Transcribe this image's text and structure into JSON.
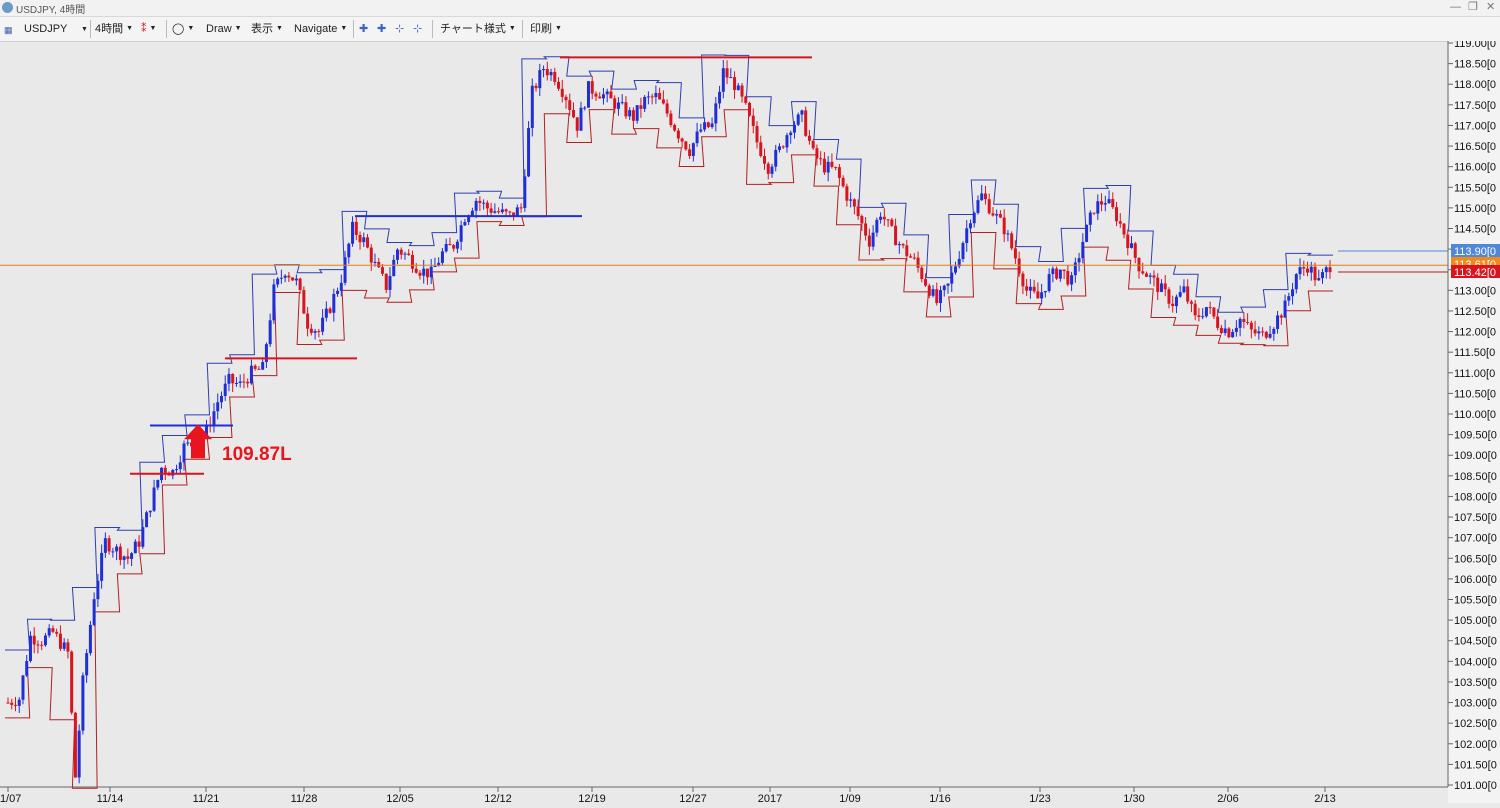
{
  "window": {
    "title": "USDJPY, 4時間"
  },
  "toolbar": {
    "symbol": "USDJPY",
    "timeframe": "4時間",
    "draw": "Draw",
    "view": "表示",
    "navigate": "Navigate",
    "chart_style": "チャート様式",
    "print": "印刷"
  },
  "annotation": {
    "label": "109.87L",
    "color": "#e8141e"
  },
  "price_tags": [
    "113.90",
    "113.61",
    "113.42"
  ],
  "chart_data": {
    "type": "candlestick",
    "symbol": "USDJPY",
    "timeframe": "4時間",
    "x_tick_labels": [
      "11/07",
      "11/14",
      "11/21",
      "11/28",
      "12/05",
      "12/12",
      "12/19",
      "12/27",
      "2017",
      "1/09",
      "1/16",
      "1/23",
      "1/30",
      "2/06",
      "2/13"
    ],
    "y_tick_labels": [
      "119.00",
      "118.50",
      "118.00",
      "117.50",
      "117.00",
      "116.50",
      "116.00",
      "115.50",
      "115.00",
      "114.50",
      "114.00",
      "113.50",
      "113.00",
      "112.50",
      "112.00",
      "111.50",
      "111.00",
      "110.50",
      "110.00",
      "109.50",
      "109.00",
      "108.50",
      "108.00",
      "107.50",
      "107.00",
      "106.50",
      "106.00",
      "105.50",
      "105.00",
      "104.50",
      "104.00",
      "103.50",
      "103.00",
      "102.50",
      "102.00",
      "101.50",
      "101.00"
    ],
    "y_range": [
      101.0,
      119.0
    ],
    "current_price": 113.61,
    "colors": {
      "up": "#1f2fd8",
      "down": "#d8141e",
      "band_upper": "#2d3fae",
      "band_lower": "#b02020",
      "current_line": "#e07f18"
    },
    "close_path": [
      [
        0,
        103.0
      ],
      [
        0.3,
        103.1
      ],
      [
        0.6,
        104.6
      ],
      [
        0.9,
        104.5
      ],
      [
        1.2,
        104.7
      ],
      [
        1.6,
        104.2
      ],
      [
        1.8,
        101.2
      ],
      [
        2.0,
        103.5
      ],
      [
        2.3,
        105.6
      ],
      [
        2.6,
        106.9
      ],
      [
        2.9,
        106.7
      ],
      [
        3.2,
        106.5
      ],
      [
        3.5,
        106.9
      ],
      [
        3.8,
        107.8
      ],
      [
        4.1,
        108.7
      ],
      [
        4.4,
        108.6
      ],
      [
        4.7,
        109.2
      ],
      [
        5.0,
        109.3
      ],
      [
        5.3,
        109.6
      ],
      [
        5.6,
        110.3
      ],
      [
        5.9,
        110.8
      ],
      [
        6.2,
        110.7
      ],
      [
        6.5,
        111.0
      ],
      [
        6.8,
        111.1
      ],
      [
        7.1,
        113.0
      ],
      [
        7.4,
        113.5
      ],
      [
        7.7,
        113.2
      ],
      [
        8.0,
        112.2
      ],
      [
        8.3,
        112.0
      ],
      [
        8.6,
        112.6
      ],
      [
        8.9,
        113.3
      ],
      [
        9.2,
        114.5
      ],
      [
        9.5,
        114.2
      ],
      [
        9.8,
        113.6
      ],
      [
        10.1,
        113.1
      ],
      [
        10.4,
        114.0
      ],
      [
        10.7,
        113.8
      ],
      [
        11.0,
        113.5
      ],
      [
        11.3,
        113.4
      ],
      [
        11.6,
        113.9
      ],
      [
        11.9,
        114.1
      ],
      [
        12.2,
        114.8
      ],
      [
        12.5,
        115.2
      ],
      [
        12.8,
        115.0
      ],
      [
        13.1,
        114.9
      ],
      [
        13.4,
        114.8
      ],
      [
        13.7,
        115.0
      ],
      [
        14.0,
        117.8
      ],
      [
        14.3,
        118.4
      ],
      [
        14.6,
        118.2
      ],
      [
        14.9,
        117.7
      ],
      [
        15.2,
        117.0
      ],
      [
        15.5,
        117.9
      ],
      [
        15.8,
        117.8
      ],
      [
        16.1,
        117.6
      ],
      [
        16.4,
        117.4
      ],
      [
        16.7,
        117.2
      ],
      [
        17.0,
        117.6
      ],
      [
        17.3,
        117.7
      ],
      [
        17.6,
        117.3
      ],
      [
        17.9,
        116.8
      ],
      [
        18.2,
        116.4
      ],
      [
        18.5,
        116.9
      ],
      [
        18.8,
        117.0
      ],
      [
        19.1,
        118.3
      ],
      [
        19.4,
        118.0
      ],
      [
        19.7,
        117.4
      ],
      [
        20.0,
        116.6
      ],
      [
        20.3,
        116.0
      ],
      [
        20.6,
        116.4
      ],
      [
        20.9,
        117.0
      ],
      [
        21.2,
        117.2
      ],
      [
        21.5,
        116.3
      ],
      [
        21.8,
        116.0
      ],
      [
        22.1,
        115.9
      ],
      [
        22.4,
        115.3
      ],
      [
        22.7,
        114.8
      ],
      [
        23.0,
        114.2
      ],
      [
        23.3,
        114.9
      ],
      [
        23.6,
        114.4
      ],
      [
        23.9,
        114.0
      ],
      [
        24.2,
        113.7
      ],
      [
        24.5,
        113.2
      ],
      [
        24.8,
        112.7
      ],
      [
        25.1,
        113.1
      ],
      [
        25.4,
        113.9
      ],
      [
        25.7,
        114.8
      ],
      [
        26.0,
        115.3
      ],
      [
        26.3,
        114.9
      ],
      [
        26.6,
        114.5
      ],
      [
        26.9,
        113.8
      ],
      [
        27.2,
        113.0
      ],
      [
        27.5,
        112.8
      ],
      [
        27.8,
        113.3
      ],
      [
        28.1,
        113.5
      ],
      [
        28.4,
        113.2
      ],
      [
        28.7,
        114.2
      ],
      [
        29.0,
        115.0
      ],
      [
        29.3,
        115.2
      ],
      [
        29.6,
        114.8
      ],
      [
        29.9,
        114.2
      ],
      [
        30.2,
        113.6
      ],
      [
        30.5,
        113.3
      ],
      [
        30.8,
        113.0
      ],
      [
        31.1,
        112.7
      ],
      [
        31.4,
        113.0
      ],
      [
        31.7,
        112.3
      ],
      [
        32.0,
        112.6
      ],
      [
        32.3,
        112.2
      ],
      [
        32.6,
        112.0
      ],
      [
        32.9,
        112.3
      ],
      [
        33.2,
        112.0
      ],
      [
        33.5,
        111.9
      ],
      [
        33.8,
        112.2
      ],
      [
        34.1,
        112.6
      ],
      [
        34.4,
        113.4
      ],
      [
        34.7,
        113.6
      ],
      [
        35.0,
        113.2
      ],
      [
        35.3,
        113.61
      ]
    ]
  }
}
